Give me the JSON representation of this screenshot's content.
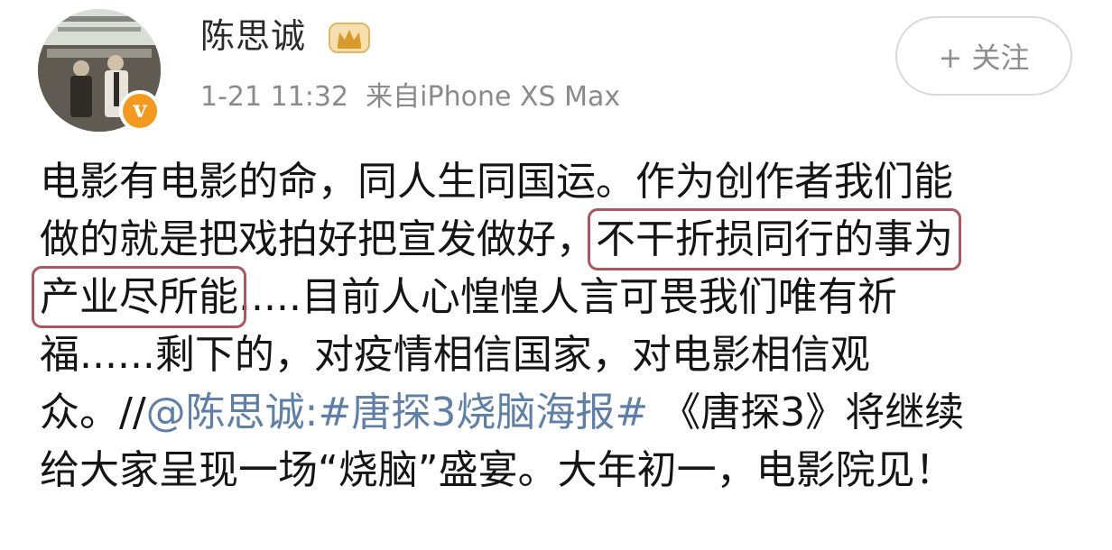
{
  "user": {
    "name": "陈思诚",
    "timestamp": "1-21 11:32",
    "source": "来自iPhone XS Max",
    "verified_icon": "v-badge-icon",
    "vip_icon": "crown-icon"
  },
  "follow_button": {
    "label": "+ 关注"
  },
  "post": {
    "line1": "电影有电影的命，同人生同国运。作为创作者我们能",
    "line2a": "做的就是把戏拍好把宣发做好，",
    "line2b": "不干折损同行的事为",
    "line3a": "产业尽所能",
    "line3b": ".....目前人心惶惶人言可畏我们唯有祈",
    "line4": "福......剩下的，对疫情相信国家，对电影相信观",
    "line5a": "众。//",
    "line5b": "@陈思诚",
    "line5c": ":",
    "line5d": "#唐探3烧脑海报#",
    "line5e": " 《唐探3》将继续",
    "line6": "给大家呈现一场“烧脑”盛宴。大年初一，电影院见！"
  },
  "colors": {
    "highlight_box": "#b0545e",
    "link": "#5e7fa8",
    "badge": "#f39a1e"
  }
}
